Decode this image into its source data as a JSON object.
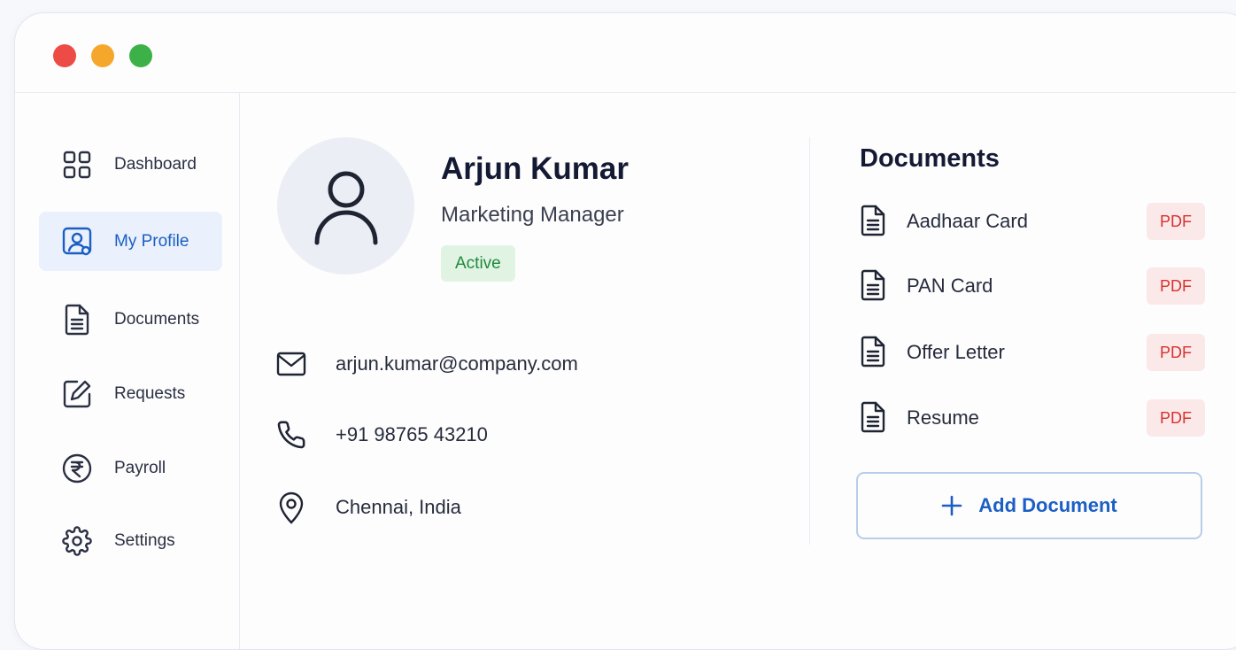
{
  "window": {
    "controls": [
      "close",
      "minimize",
      "maximize"
    ],
    "colors": {
      "close": "#ed4b45",
      "minimize": "#f5a72c",
      "maximize": "#3cb148"
    }
  },
  "sidebar": {
    "items": [
      {
        "label": "Dashboard",
        "icon": "grid-icon",
        "active": false
      },
      {
        "label": "My Profile",
        "icon": "profile-card-icon",
        "active": true
      },
      {
        "label": "Documents",
        "icon": "document-icon",
        "active": false
      },
      {
        "label": "Requests",
        "icon": "edit-icon",
        "active": false
      },
      {
        "label": "Payroll",
        "icon": "rupee-icon",
        "active": false
      },
      {
        "label": "Settings",
        "icon": "gear-icon",
        "active": false
      }
    ]
  },
  "profile": {
    "avatar_icon": "user-icon",
    "name": "Arjun Kumar",
    "role": "Marketing Manager",
    "status": "Active",
    "contacts": [
      {
        "icon": "mail-icon",
        "value": "arjun.kumar@company.com"
      },
      {
        "icon": "phone-icon",
        "value": "+91 98765 43210"
      },
      {
        "icon": "location-pin-icon",
        "value": "Chennai, India"
      }
    ]
  },
  "documents": {
    "title": "Documents",
    "items": [
      {
        "name": "Aadhaar Card",
        "type": "PDF"
      },
      {
        "name": "PAN Card",
        "type": "PDF"
      },
      {
        "name": "Offer Letter",
        "type": "PDF"
      },
      {
        "name": "Resume",
        "type": "PDF"
      }
    ],
    "add_button": "Add Document"
  },
  "colors": {
    "accent": "#1b5fc4",
    "active_nav_bg": "#eaf1fc",
    "status_bg": "#e1f4e4",
    "status_text": "#1f8a3a",
    "pdf_bg": "#fbe9e9",
    "pdf_text": "#d8302e"
  }
}
